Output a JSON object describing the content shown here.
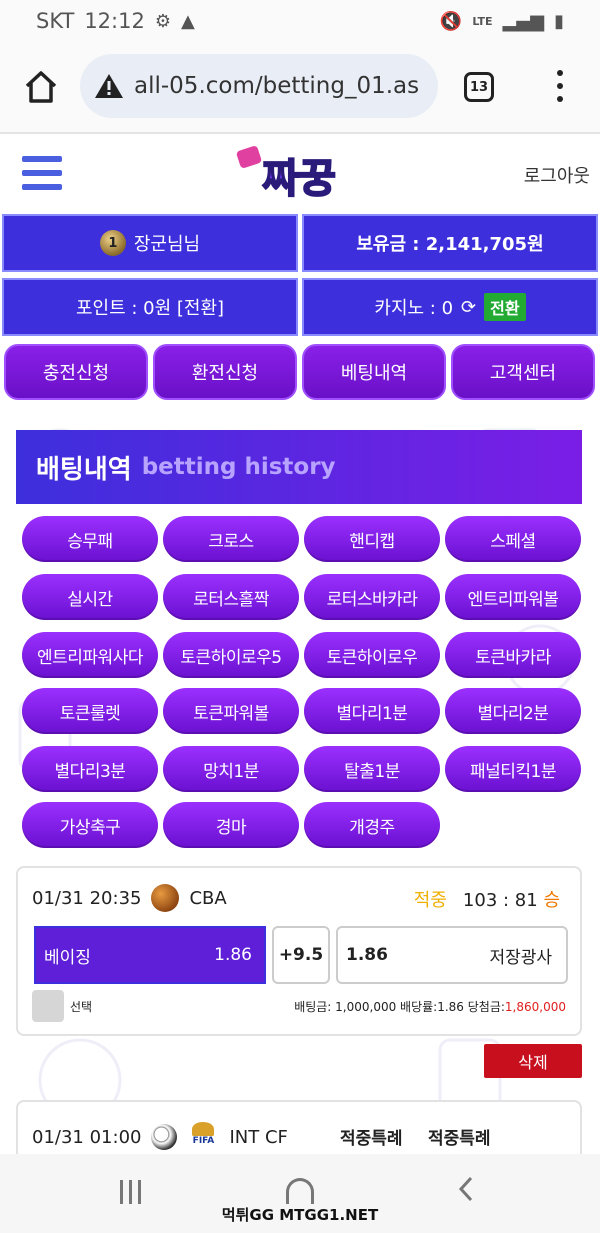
{
  "status_bar": {
    "carrier": "SKT",
    "time": "12:12",
    "network": "LTE",
    "left_icons": [
      "gear-icon",
      "warning-icon"
    ],
    "right_icons": [
      "mute-icon",
      "signal-icon",
      "battery-icon"
    ]
  },
  "browser": {
    "url": "all-05.com/betting_01.as",
    "tab_count": "13"
  },
  "header": {
    "logo_text": "짜꿍",
    "logout": "로그아웃"
  },
  "account": {
    "user": "장군님님",
    "level_badge": "1",
    "balance": "보유금 : 2,141,705원",
    "points": "포인트 : 0원 [전환]",
    "casino": "카지노 : 0",
    "casino_convert": "전환"
  },
  "actions": [
    "충전신청",
    "환전신청",
    "베팅내역",
    "고객센터"
  ],
  "history_banner": {
    "title_ko": "배팅내역",
    "title_en": "betting history"
  },
  "game_tabs": [
    "승무패",
    "크로스",
    "핸디캡",
    "스페셜",
    "실시간",
    "로터스홀짝",
    "로터스바카라",
    "엔트리파워볼",
    "엔트리파워사다",
    "토큰하이로우5",
    "토큰하이로우",
    "토큰바카라",
    "토큰룰렛",
    "토큰파워볼",
    "별다리1분",
    "별다리2분",
    "별다리3분",
    "망치1분",
    "탈출1분",
    "패널티킥1분",
    "가상축구",
    "경마",
    "개경주"
  ],
  "bets": [
    {
      "datetime": "01/31 20:35",
      "league": "CBA",
      "result_label": "적중",
      "score": "103 : 81",
      "outcome": "승",
      "home_team": "베이징",
      "home_odds": "1.86",
      "handicap": "+9.5",
      "away_odds": "1.86",
      "away_team": "저장광사",
      "select_label": "선택",
      "bet_amount_text": "배팅금: 1,000,000 배당률:1.86 당첨금:",
      "payout": "1,860,000"
    },
    {
      "datetime": "01/31 01:00",
      "league": "INT CF",
      "fifa_text": "FIFA",
      "special_1": "적중특례",
      "special_2": "적중특례"
    }
  ],
  "delete_button": "삭제",
  "watermark": "먹튀GG MTGG1.NET",
  "colors": {
    "primary_blue": "#3d2fdc",
    "button_purple": "#7a1ee6",
    "hit_yellow": "#f0b000",
    "win_orange": "#f07800",
    "delete_red": "#c80f1e",
    "convert_green": "#22aa33"
  }
}
